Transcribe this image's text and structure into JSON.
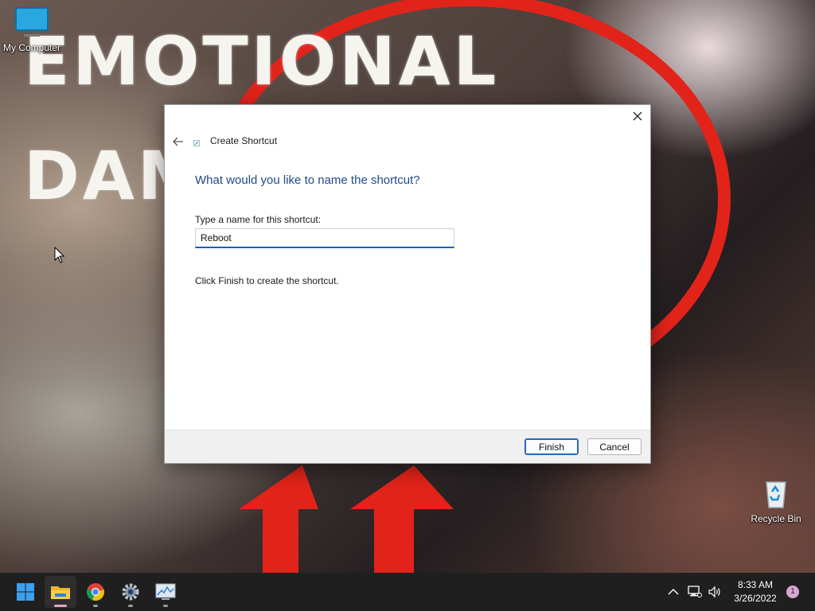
{
  "desktop": {
    "wallpaper_text_1": "EMOTIONAL",
    "wallpaper_text_2": "DAM",
    "icons": [
      {
        "label": "My Computer"
      },
      {
        "label": "Recycle Bin"
      }
    ]
  },
  "dialog": {
    "title": "Create Shortcut",
    "heading": "What would you like to name the shortcut?",
    "field_label": "Type a name for this shortcut:",
    "name_value": "Reboot",
    "hint": "Click Finish to create the shortcut.",
    "finish_label": "Finish",
    "cancel_label": "Cancel",
    "accent_color": "#1e4a86"
  },
  "taskbar": {
    "apps": [
      {
        "name": "start",
        "icon": "windows-logo-icon"
      },
      {
        "name": "file-explorer",
        "icon": "folder-icon",
        "active": true
      },
      {
        "name": "chrome",
        "icon": "chrome-icon"
      },
      {
        "name": "settings",
        "icon": "gear-icon"
      },
      {
        "name": "resource-monitor",
        "icon": "monitor-chart-icon"
      }
    ],
    "tray_icons": [
      "chevron-up-icon",
      "network-icon",
      "volume-icon"
    ],
    "time": "8:33 AM",
    "date": "3/26/2022",
    "notification_count": "1"
  }
}
